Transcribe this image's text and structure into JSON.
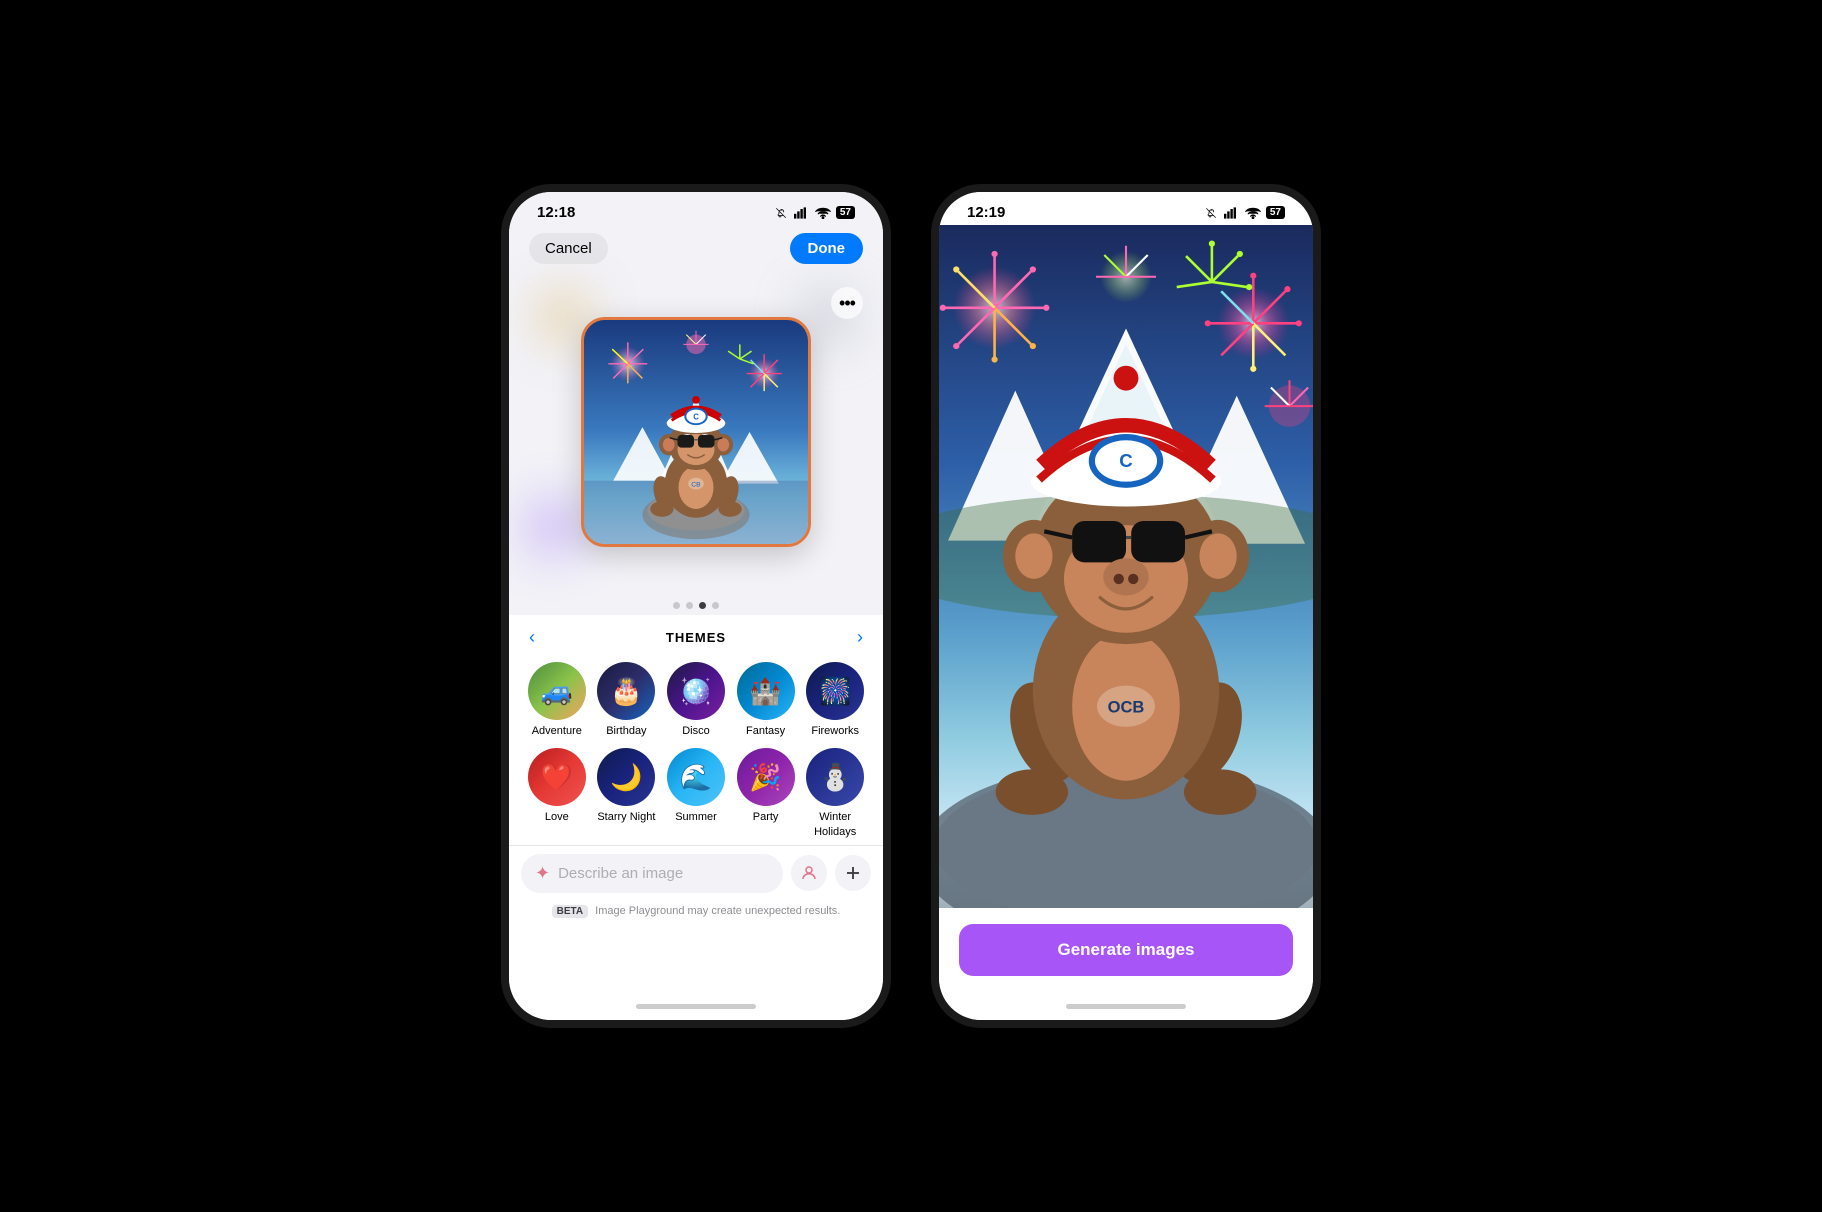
{
  "left_phone": {
    "status_bar": {
      "time": "12:18",
      "battery": "57"
    },
    "top_nav": {
      "cancel_label": "Cancel",
      "done_label": "Done"
    },
    "pagination": {
      "dots": [
        false,
        false,
        true,
        false
      ]
    },
    "themes": {
      "title": "THEMES",
      "prev_label": "<",
      "next_label": ">",
      "items": [
        {
          "id": "adventure",
          "label": "Adventure",
          "emoji": "🚙"
        },
        {
          "id": "birthday",
          "label": "Birthday",
          "emoji": "🎂"
        },
        {
          "id": "disco",
          "label": "Disco",
          "emoji": "🪩"
        },
        {
          "id": "fantasy",
          "label": "Fantasy",
          "emoji": "🏰"
        },
        {
          "id": "fireworks",
          "label": "Fireworks",
          "emoji": "🎆"
        },
        {
          "id": "love",
          "label": "Love",
          "emoji": "❤️"
        },
        {
          "id": "starry",
          "label": "Starry Night",
          "emoji": "🌙"
        },
        {
          "id": "summer",
          "label": "Summer",
          "emoji": "🌊"
        },
        {
          "id": "party",
          "label": "Party",
          "emoji": "🎉"
        },
        {
          "id": "winter",
          "label": "Winter Holidays",
          "emoji": "⛄"
        }
      ]
    },
    "input": {
      "placeholder": "Describe an image"
    },
    "beta_text": "Image Playground may create unexpected results.",
    "beta_label": "BETA"
  },
  "right_phone": {
    "status_bar": {
      "time": "12:19",
      "battery": "57"
    },
    "generate_button_label": "Generate images"
  }
}
